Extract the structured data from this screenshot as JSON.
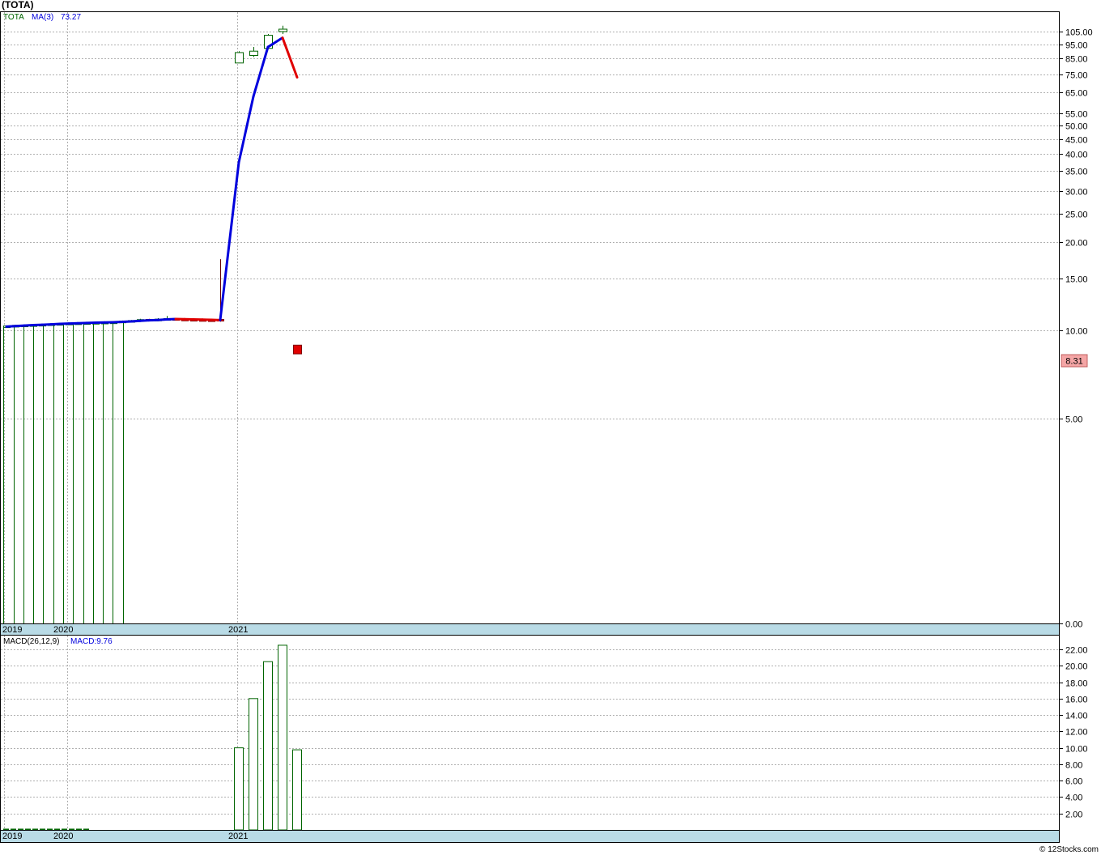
{
  "header": {
    "title": "(TOTA)"
  },
  "price_legend": {
    "symbol": "TOTA",
    "ma_label": "MA(3)",
    "ma_value": "73.27"
  },
  "macd_legend": {
    "label": "MACD(26,12,9)",
    "value": "MACD:9.76"
  },
  "last_price_badge": "8.31",
  "copyright": "© 12Stocks.com",
  "colors": {
    "up": "#006400",
    "down": "#e00000",
    "ma": "#0000dd",
    "axis_band": "#b9dbe6",
    "grid": "#b0b0b0"
  },
  "chart_data": [
    {
      "type": "candlestick",
      "title": "(TOTA)",
      "scale": "log",
      "y_ticks": [
        "105.00",
        "95.00",
        "85.00",
        "75.00",
        "65.00",
        "55.00",
        "50.00",
        "45.00",
        "40.00",
        "35.00",
        "30.00",
        "25.00",
        "20.00",
        "15.00",
        "10.00",
        "5.00",
        "0.00"
      ],
      "x_labels": [
        "2019",
        "2020",
        "2021"
      ],
      "candles": [
        {
          "o": 10.35,
          "h": 10.4,
          "l": 10.3,
          "c": 10.35
        },
        {
          "o": 10.38,
          "h": 10.42,
          "l": 10.35,
          "c": 10.4
        },
        {
          "o": 10.4,
          "h": 10.45,
          "l": 10.38,
          "c": 10.42
        },
        {
          "o": 10.42,
          "h": 10.48,
          "l": 10.4,
          "c": 10.45
        },
        {
          "o": 10.45,
          "h": 10.5,
          "l": 10.43,
          "c": 10.48
        },
        {
          "o": 10.48,
          "h": 10.55,
          "l": 10.45,
          "c": 10.52
        },
        {
          "o": 10.52,
          "h": 10.6,
          "l": 10.5,
          "c": 10.55
        },
        {
          "o": 10.55,
          "h": 10.62,
          "l": 10.52,
          "c": 10.58
        },
        {
          "o": 10.58,
          "h": 10.65,
          "l": 10.55,
          "c": 10.6
        },
        {
          "o": 10.6,
          "h": 10.68,
          "l": 10.58,
          "c": 10.62
        },
        {
          "o": 10.62,
          "h": 10.7,
          "l": 10.6,
          "c": 10.64
        },
        {
          "o": 10.64,
          "h": 10.7,
          "l": 10.6,
          "c": 10.66
        },
        {
          "o": 10.66,
          "h": 10.72,
          "l": 10.62,
          "c": 10.68
        },
        {
          "o": 10.68,
          "h": 10.8,
          "l": 10.65,
          "c": 10.75
        },
        {
          "o": 10.75,
          "h": 10.85,
          "l": 10.72,
          "c": 10.8
        },
        {
          "o": 10.82,
          "h": 10.95,
          "l": 10.8,
          "c": 10.88
        },
        {
          "o": 10.9,
          "h": 10.95,
          "l": 10.82,
          "c": 10.86
        },
        {
          "o": 10.9,
          "h": 11.0,
          "l": 10.85,
          "c": 10.92
        },
        {
          "o": 10.95,
          "h": 11.2,
          "l": 10.9,
          "c": 10.97
        },
        {
          "o": 10.97,
          "h": 11.0,
          "l": 10.88,
          "c": 10.92
        },
        {
          "o": 10.92,
          "h": 10.96,
          "l": 10.88,
          "c": 10.9
        },
        {
          "o": 10.9,
          "h": 10.93,
          "l": 10.85,
          "c": 10.88
        },
        {
          "o": 10.88,
          "h": 10.9,
          "l": 10.84,
          "c": 10.86
        },
        {
          "o": 10.86,
          "h": 10.9,
          "l": 10.82,
          "c": 10.85
        },
        {
          "o": 10.9,
          "h": 17.5,
          "l": 10.7,
          "c": 10.8
        },
        {
          "o": 82.0,
          "h": 90.0,
          "l": 82.0,
          "c": 89.0
        },
        {
          "o": 87.0,
          "h": 93.0,
          "l": 86.0,
          "c": 90.0
        },
        {
          "o": 92.0,
          "h": 103.0,
          "l": 92.0,
          "c": 102.0
        },
        {
          "o": 105.0,
          "h": 110.0,
          "l": 103.0,
          "c": 107.0
        },
        {
          "o": 8.9,
          "h": 8.9,
          "l": 8.31,
          "c": 8.31
        }
      ],
      "ma3": [
        10.3,
        10.34,
        10.38,
        10.42,
        10.45,
        10.48,
        10.52,
        10.55,
        10.57,
        10.6,
        10.62,
        10.64,
        10.66,
        10.69,
        10.73,
        10.78,
        10.82,
        10.85,
        10.9,
        10.93,
        10.92,
        10.9,
        10.88,
        10.86,
        10.84,
        37.5,
        63.0,
        93.0,
        100.0,
        73.27
      ],
      "volume": [
        10.3,
        10.3,
        10.3,
        10.35,
        10.4,
        10.5,
        10.52,
        10.55,
        10.58,
        10.6,
        10.62,
        10.65,
        10.68
      ]
    },
    {
      "type": "bar",
      "title": "MACD(26,12,9)",
      "y_ticks": [
        "22.00",
        "20.00",
        "18.00",
        "16.00",
        "14.00",
        "12.00",
        "10.00",
        "8.00",
        "6.00",
        "4.00",
        "2.00"
      ],
      "x_labels": [
        "2019",
        "2020",
        "2021"
      ],
      "values": [
        0.1,
        0.1,
        0.1,
        0.1,
        0.1,
        0.1,
        0.1,
        0.1,
        0.1,
        0.1,
        0.1,
        0.1,
        0.1,
        0.1,
        0.1,
        0.1,
        0.1,
        0.1,
        0.1,
        0.1,
        0.1,
        0.1,
        0.1,
        0.1,
        0.1,
        10.0,
        16.0,
        20.5,
        22.5,
        9.76
      ]
    }
  ]
}
